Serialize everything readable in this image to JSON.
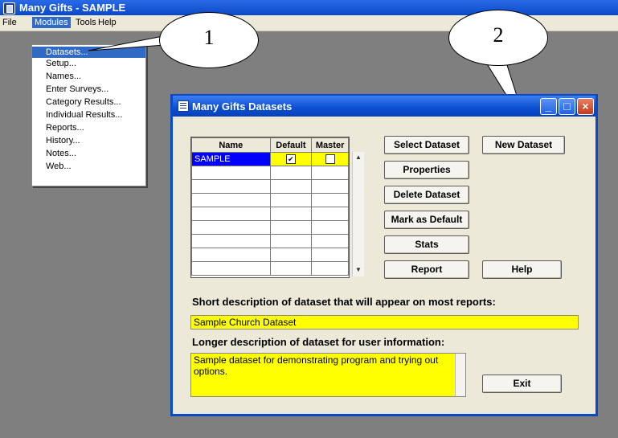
{
  "window": {
    "title": "Many Gifts - SAMPLE"
  },
  "menubar": {
    "items": [
      "File",
      "Modules",
      "Tools",
      "Help"
    ]
  },
  "modules_menu": {
    "items": [
      "Datasets...",
      "Setup...",
      "Names...",
      "Enter Surveys...",
      "Category Results...",
      "Individual Results...",
      "Reports...",
      "History...",
      "Notes...",
      "Web..."
    ],
    "selected_index": 0
  },
  "callouts": [
    "1",
    "2"
  ],
  "dialog": {
    "title": "Many Gifts Datasets",
    "grid": {
      "columns": [
        "Name",
        "Default",
        "Master"
      ],
      "rows": [
        {
          "name": "SAMPLE",
          "default": true,
          "master": false
        }
      ]
    },
    "buttons": {
      "select_dataset": "Select Dataset",
      "new_dataset": "New Dataset",
      "properties": "Properties",
      "delete_dataset": "Delete Dataset",
      "mark_as_default": "Mark as Default",
      "stats": "Stats",
      "report": "Report",
      "help": "Help",
      "exit": "Exit"
    },
    "short_desc_label": "Short description of dataset that will appear on most reports:",
    "short_desc_value": "Sample Church Dataset",
    "long_desc_label": "Longer description of dataset for user information:",
    "long_desc_value": "Sample dataset for demonstrating program and trying out options."
  },
  "colors": {
    "titlebar": "#0a49c8",
    "highlight": "#ffff00",
    "menu_select": "#316ac5",
    "client_bg": "#7f7f7f"
  }
}
